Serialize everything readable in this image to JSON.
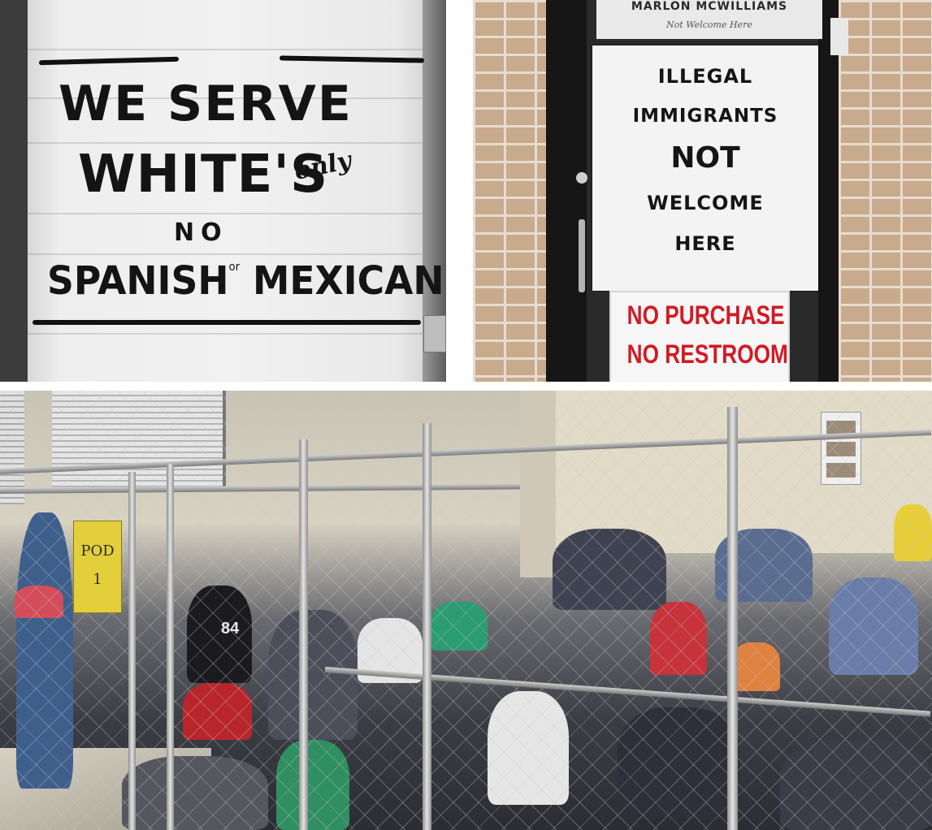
{
  "collage": {
    "top_left": {
      "sign_line1": "WE SERVE",
      "sign_line2": "WHITE'S",
      "sign_only": "only",
      "sign_line3": "NO",
      "sign_line4a": "SPANISH",
      "sign_or": "or",
      "sign_line4b": "MEXICANS"
    },
    "top_right": {
      "plaque_line1": "MARLON MCWILLIAMS",
      "plaque_line2": "Not Welcome Here",
      "notice_line1": "ILLEGAL",
      "notice_line2": "IMMIGRANTS",
      "notice_line3": "NOT",
      "notice_line4": "WELCOME",
      "notice_line5": "HERE",
      "restroom_line1": "NO PURCHASE",
      "restroom_line2": "NO RESTROOM"
    },
    "bottom": {
      "pod_sign_line1": "POD",
      "pod_sign_line2": "1",
      "jersey_number": "84"
    }
  },
  "colors": {
    "sign_ink": "#141414",
    "notice_red": "#d11b24",
    "pod_sign_yellow": "#e3cf3c"
  }
}
